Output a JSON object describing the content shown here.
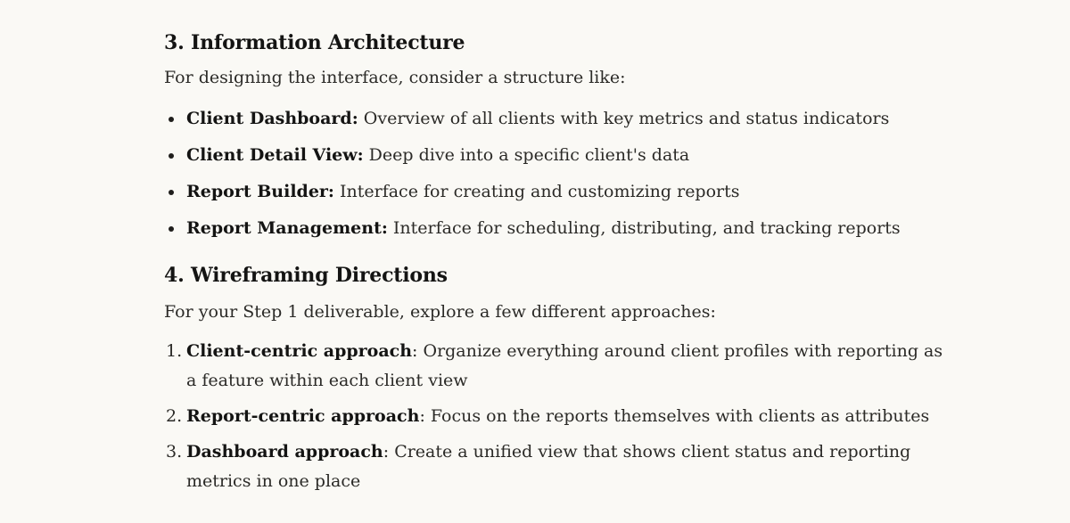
{
  "section3": {
    "heading": "3. Information Architecture",
    "intro": "For designing the interface, consider a structure like:",
    "items": [
      {
        "term": "Client Dashboard:",
        "text": " Overview of all clients with key metrics and status indicators"
      },
      {
        "term": "Client Detail View:",
        "text": " Deep dive into a specific client's data"
      },
      {
        "term": "Report Builder:",
        "text": " Interface for creating and customizing reports"
      },
      {
        "term": "Report Management:",
        "text": " Interface for scheduling, distributing, and tracking reports"
      }
    ]
  },
  "section4": {
    "heading": "4. Wireframing Directions",
    "intro": "For your Step 1 deliverable, explore a few different approaches:",
    "items": [
      {
        "number": "1.",
        "term": "Client-centric approach",
        "text": ": Organize everything around client profiles with reporting as a feature within each client view"
      },
      {
        "number": "2.",
        "term": "Report-centric approach",
        "text": ": Focus on the reports themselves with clients as attributes"
      },
      {
        "number": "3.",
        "term": "Dashboard approach",
        "text": ": Create a unified view that shows client status and reporting metrics in one place"
      }
    ]
  }
}
